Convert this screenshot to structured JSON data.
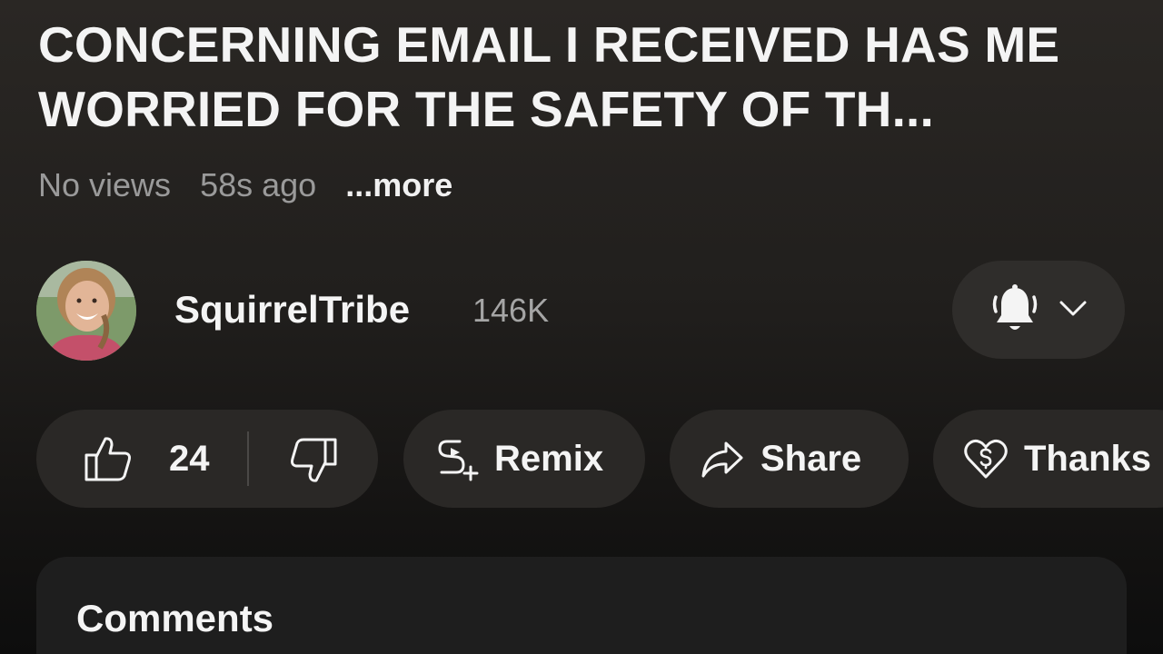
{
  "video": {
    "title": "CONCERNING EMAIL I RECEIVED HAS ME WORRIED FOR THE SAFETY OF TH...",
    "views": "No views",
    "age": "58s ago",
    "more": "...more"
  },
  "channel": {
    "name": "SquirrelTribe",
    "subscribers": "146K",
    "subscription_icon": "bell-icon"
  },
  "actions": {
    "like_count": "24",
    "remix_label": "Remix",
    "share_label": "Share",
    "thanks_label": "Thanks"
  },
  "comments": {
    "heading": "Comments"
  },
  "colors": {
    "background": "#211f1d",
    "pill": "#2a2826",
    "text": "#f1f1f1",
    "muted": "#9a9a9a"
  }
}
